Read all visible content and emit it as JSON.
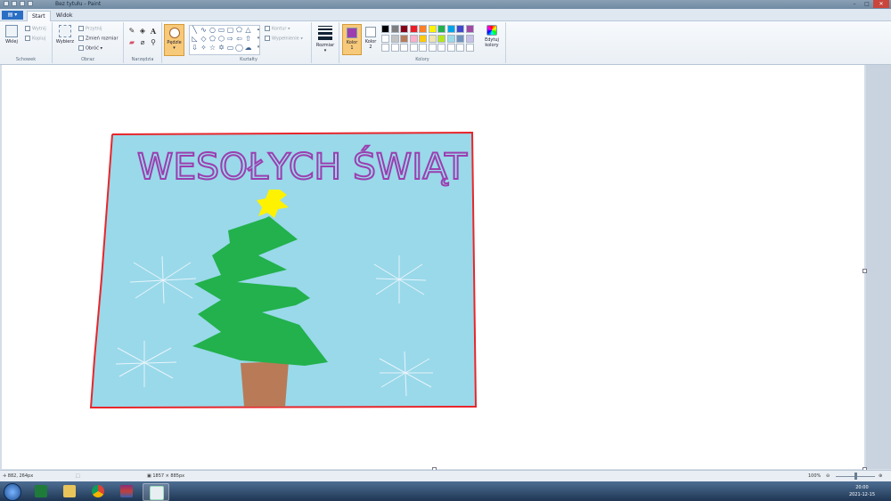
{
  "window": {
    "title": "Bez tytułu - Paint"
  },
  "tabs": {
    "file": "▤ ▾",
    "start": "Start",
    "view": "Widok"
  },
  "ribbon": {
    "clipboard": {
      "group": "Schowek",
      "paste": "Wklej",
      "cut": "Wytnij",
      "copy": "Kopiuj"
    },
    "image": {
      "group": "Obraz",
      "select": "Wybierz",
      "crop": "Przytnij",
      "resize": "Zmień rozmiar",
      "rotate": "Obróć ▾"
    },
    "tools": {
      "group": "Narzędzia",
      "text_tool": "A"
    },
    "brushes": {
      "label": "Pędzle"
    },
    "shapes": {
      "group": "Kształty",
      "outline": "Kontur ▾",
      "fill": "Wypełnienie ▾"
    },
    "size": {
      "label": "Rozmiar"
    },
    "colors": {
      "group": "Kolory",
      "color1": "Kolor 1",
      "color2": "Kolor 2",
      "edit": "Edytuj kolory",
      "color1_value": "#9b3fb0",
      "color2_value": "#ffffff",
      "row1": [
        "#000000",
        "#7f7f7f",
        "#880015",
        "#ed1c24",
        "#ff7f27",
        "#fff200",
        "#22b14c",
        "#00a2e8",
        "#3f48cc",
        "#a349a4"
      ],
      "row2": [
        "#ffffff",
        "#c3c3c3",
        "#b97a57",
        "#ffaec9",
        "#ffc90e",
        "#efe4b0",
        "#b5e61d",
        "#99d9ea",
        "#7092be",
        "#c8bfe7"
      ],
      "row3": [
        "#ffffff",
        "#ffffff",
        "#ffffff",
        "#ffffff",
        "#ffffff",
        "#ffffff",
        "#ffffff",
        "#ffffff",
        "#ffffff",
        "#ffffff"
      ]
    }
  },
  "drawing": {
    "text": "WESOŁYCH ŚWIĄT",
    "border_color": "#e8262b",
    "sky_color": "#99d9ea",
    "tree_color": "#22b14c",
    "trunk_color": "#b97a57",
    "star_color": "#fff200"
  },
  "status": {
    "cursor": "882, 264px",
    "size": "1857 × 885px",
    "zoom": "100%"
  },
  "taskbar": {
    "time": "20:00",
    "date": "2021-12-15"
  }
}
